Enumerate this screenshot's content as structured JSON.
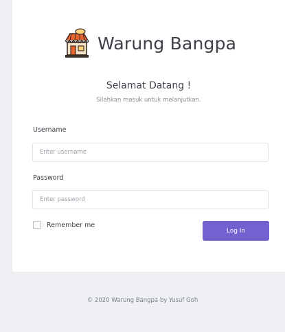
{
  "brand": {
    "name": "Warung Bangpa",
    "icon": "store-icon"
  },
  "welcome": {
    "title": "Selamat Datang !",
    "subtitle": "Silahkan masuk untuk melanjutkan."
  },
  "form": {
    "username_label": "Username",
    "username_placeholder": "Enter username",
    "username_value": "",
    "password_label": "Password",
    "password_placeholder": "Enter password",
    "password_value": "",
    "remember_label": "Remember me",
    "remember_checked": false,
    "login_label": "Log In"
  },
  "footer": {
    "text": "© 2020 Warung Bangpa by Yusuf Goh"
  },
  "colors": {
    "accent": "#7262d0",
    "background": "#eef0f3",
    "card": "#ffffff"
  }
}
